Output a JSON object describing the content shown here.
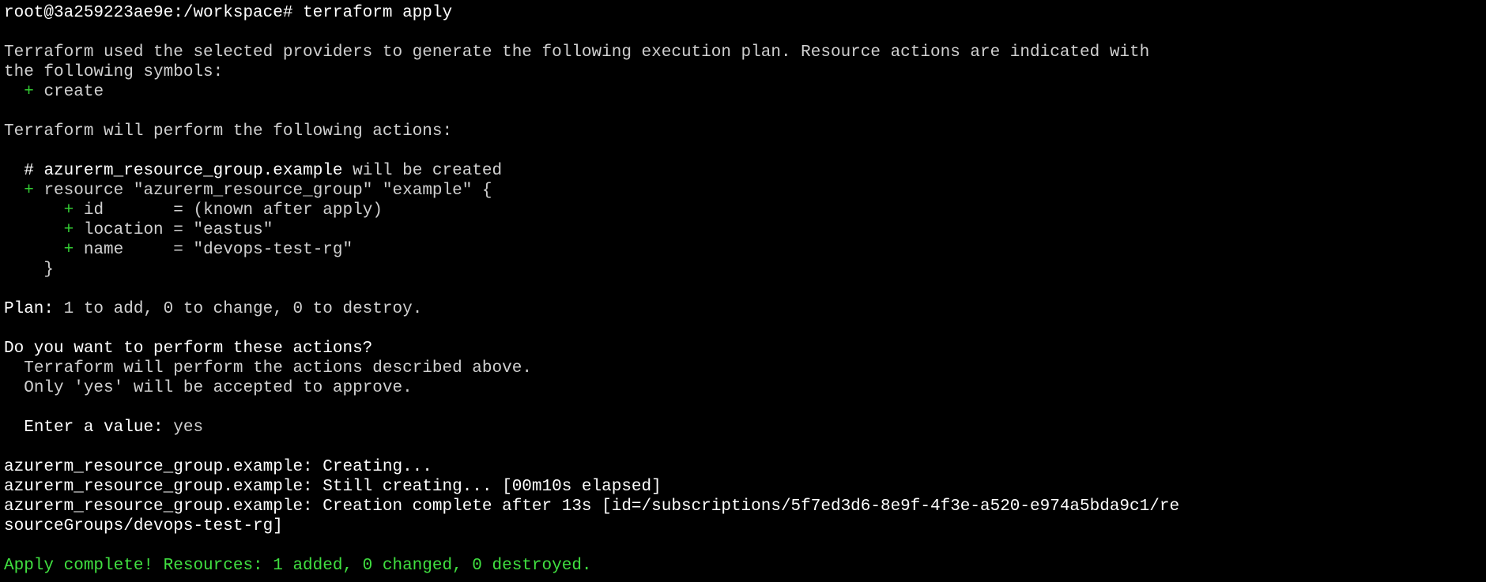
{
  "terminal": {
    "prompt": "root@3a259223ae9e:/workspace# ",
    "command": "terraform apply",
    "intro_line1": "Terraform used the selected providers to generate the following execution plan. Resource actions are indicated with",
    "intro_line2": "the following symbols:",
    "symbol_plus": "+",
    "symbol_create": "create",
    "will_perform": "Terraform will perform the following actions:",
    "comment_hash": "#",
    "comment_resource": "azurerm_resource_group.example",
    "comment_tail": " will be created",
    "resource_decl": "resource \"azurerm_resource_group\" \"example\" {",
    "attrs": [
      {
        "key": "id       ",
        "value": "(known after apply)"
      },
      {
        "key": "location ",
        "value": "\"eastus\""
      },
      {
        "key": "name     ",
        "value": "\"devops-test-rg\""
      }
    ],
    "close_brace": "}",
    "plan_label": "Plan:",
    "plan_text": " 1 to add, 0 to change, 0 to destroy.",
    "confirm_question": "Do you want to perform these actions?",
    "confirm_detail1": "Terraform will perform the actions described above.",
    "confirm_detail2": "Only 'yes' will be accepted to approve.",
    "enter_label": "Enter a value: ",
    "enter_value": "yes",
    "progress1": "azurerm_resource_group.example: Creating...",
    "progress2": "azurerm_resource_group.example: Still creating... [00m10s elapsed]",
    "progress3a": "azurerm_resource_group.example: Creation complete after 13s [id=/subscriptions/5f7ed3d6-8e9f-4f3e-a520-e974a5bda9c1/re",
    "progress3b": "sourceGroups/devops-test-rg]",
    "apply_complete": "Apply complete! Resources: 1 added, 0 changed, 0 destroyed."
  },
  "colors": {
    "background": "#000000",
    "text": "#d0d0d0",
    "bright": "#ffffff",
    "plus_green": "#33cc33",
    "success_green": "#40e040"
  }
}
